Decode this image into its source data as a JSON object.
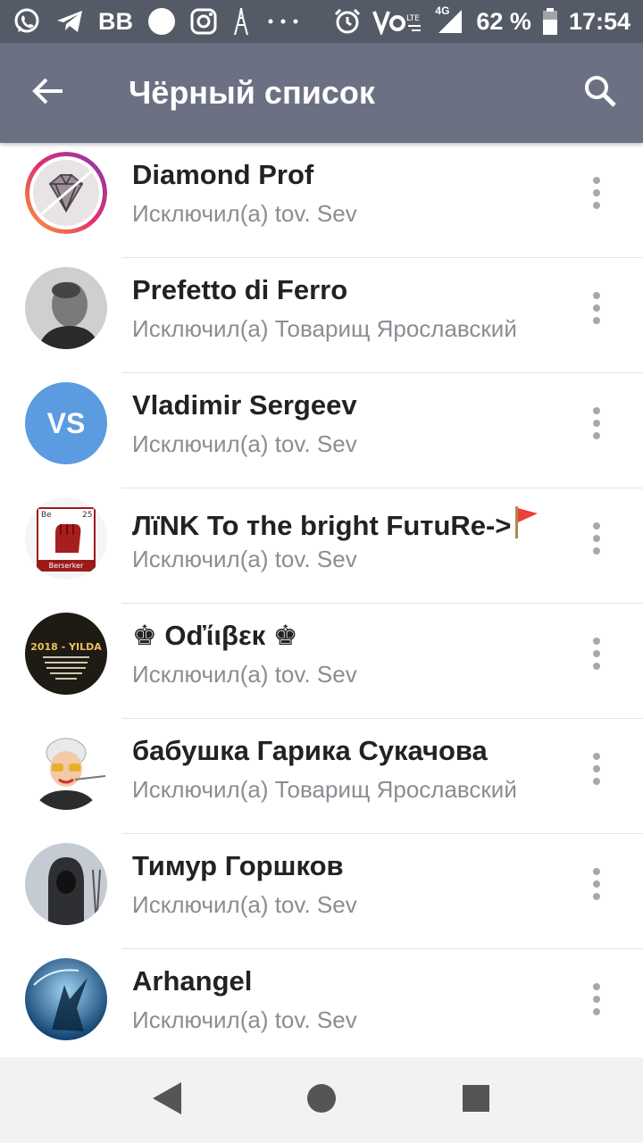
{
  "status_bar": {
    "bb_label": "BB",
    "battery_text": "62 %",
    "time": "17:54",
    "network_label": "4G",
    "icons": [
      "whatsapp-icon",
      "telegram-icon",
      "bb-icon",
      "circle-icon",
      "instagram-icon",
      "eiffel-tower-icon",
      "more-dots-icon",
      "alarm-icon",
      "volte-icon",
      "signal-icon",
      "battery-icon"
    ]
  },
  "app_bar": {
    "title": "Чёрный список",
    "back_icon": "arrow-left-icon",
    "search_icon": "search-icon"
  },
  "list": [
    {
      "name": "Diamond Prof",
      "subtitle": "Исключил(а) tov. Sev",
      "avatar": "diamond-avatar"
    },
    {
      "name": "Prefetto di Ferro",
      "subtitle": "Исключил(а) Товарищ Ярославский",
      "avatar": "photo-avatar"
    },
    {
      "name": "Vladimir Sergeev",
      "subtitle": "Исключил(а) tov. Sev",
      "avatar_initials": "VS"
    },
    {
      "name": "ЛїNK To тhe bright FuтuRe->",
      "subtitle": "Исключил(а) tov. Sev",
      "name_emoji": "red-flag-icon",
      "avatar": "fist-avatar",
      "avatar_label_top_left": "Be",
      "avatar_label_top_right": "25",
      "avatar_label_bottom": "Berserker"
    },
    {
      "name": "♚ Οďίιβεк ♚",
      "subtitle": "Исключил(а) tov. Sev",
      "avatar": "dark-poster-avatar",
      "avatar_label": "2018 - YILDA"
    },
    {
      "name": "бабушка Гарика Сукачова",
      "subtitle": "Исключил(а) Товарищ Ярославский",
      "avatar": "grandma-avatar"
    },
    {
      "name": "Тимур Горшков",
      "subtitle": "Исключил(а) tov. Sev",
      "avatar": "hooded-avatar"
    },
    {
      "name": "Arhangel",
      "subtitle": "Исключил(а) tov. Sev",
      "avatar": "blue-angel-avatar"
    }
  ],
  "nav_bar": {
    "icons": [
      "back-triangle-icon",
      "home-circle-icon",
      "recents-square-icon"
    ]
  },
  "colors": {
    "status_bar": "#555b66",
    "app_bar": "#6b7183",
    "vs_avatar": "#5b9be0",
    "subtitle": "#8a8d92",
    "divider": "#e2e4e7",
    "flag": "#e8403a"
  }
}
